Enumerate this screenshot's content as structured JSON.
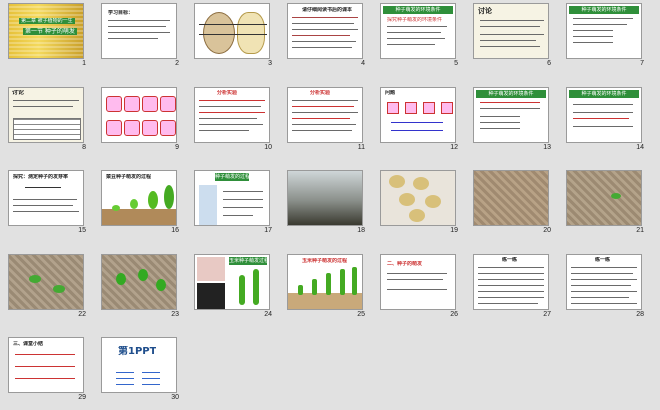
{
  "window": {
    "title": "Slide sorter"
  },
  "slides": [
    {
      "num": "1",
      "title": "第二章 被子植物的一生",
      "subtitle": "第一节 种子的萌发"
    },
    {
      "num": "2",
      "title": "学习目标："
    },
    {
      "num": "3"
    },
    {
      "num": "4",
      "title": "请仔细阅读书后的课本"
    },
    {
      "num": "5",
      "title": "种子萌发的环境条件",
      "subtitle": "探究种子萌发的环境条件"
    },
    {
      "num": "6",
      "title": "讨论"
    },
    {
      "num": "7",
      "title": "种子萌发的环境条件"
    },
    {
      "num": "8",
      "title": "讨论"
    },
    {
      "num": "9"
    },
    {
      "num": "10",
      "title": "分析实验"
    },
    {
      "num": "11",
      "title": "分析实验"
    },
    {
      "num": "12",
      "title": "问题"
    },
    {
      "num": "13",
      "title": "种子萌发的环境条件"
    },
    {
      "num": "14",
      "title": "种子萌发的环境条件"
    },
    {
      "num": "15",
      "title": "探究：测定种子的发芽率"
    },
    {
      "num": "16",
      "title": "菜豆种子萌发的过程"
    },
    {
      "num": "17",
      "title": "种子萌发的过程"
    },
    {
      "num": "18"
    },
    {
      "num": "19"
    },
    {
      "num": "20"
    },
    {
      "num": "21"
    },
    {
      "num": "22"
    },
    {
      "num": "23"
    },
    {
      "num": "24",
      "title": "玉米种子萌发过程"
    },
    {
      "num": "25",
      "title": "玉米种子萌发的过程"
    },
    {
      "num": "26",
      "title": "二、种子的萌发"
    },
    {
      "num": "27",
      "title": "练一练"
    },
    {
      "num": "28",
      "title": "练一练"
    },
    {
      "num": "29",
      "title": "三、课堂小结"
    },
    {
      "num": "30",
      "title": "第1PPT"
    }
  ]
}
